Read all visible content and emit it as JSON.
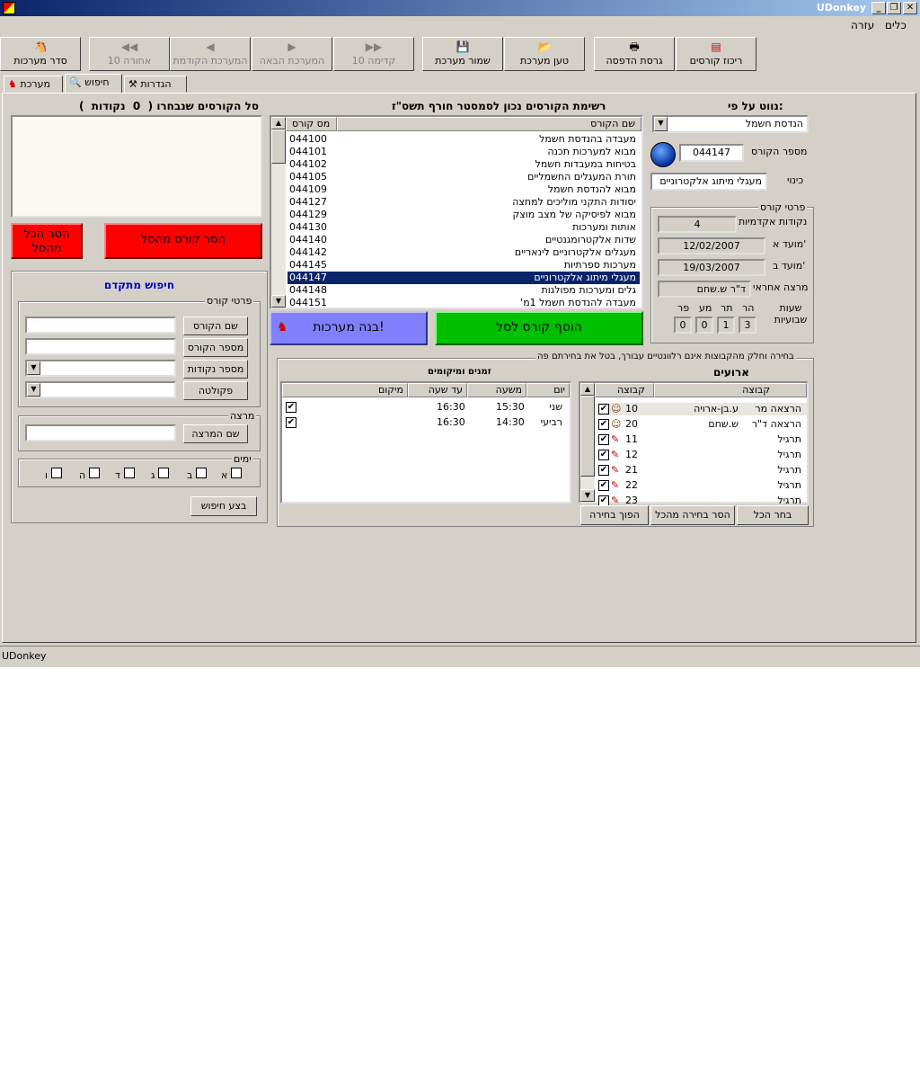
{
  "window": {
    "title": "UDonkey"
  },
  "menu": {
    "tools": "כלים",
    "help": "עזרה"
  },
  "toolbar": {
    "build": "סדר מערכות",
    "last10": "אחורה 10",
    "prev": "המערכת הקודמת",
    "next": "המערכת הבאה",
    "forward10": "קדימה 10",
    "save": "שמור מערכת",
    "load": "טען מערכת",
    "print": "גרסת הדפסה",
    "summary": "ריכוז קורסים"
  },
  "tabs": {
    "schedule": "מערכת",
    "search": "חיפוש",
    "settings": "הגדרות"
  },
  "basket": {
    "title": "סל הקורסים שנבחרו",
    "open": "(",
    "points": "0",
    "points_label": "נקודות",
    "close": ")",
    "remove_all": "הסר הכל מהסל",
    "remove_course": "הסר קורס מהסל"
  },
  "search": {
    "title": "חיפוש מתקדם",
    "course_details": "פרטי קורס",
    "course_name": "שם הקורס",
    "course_number": "מספר הקורס",
    "points": "מספר נקודות",
    "faculty": "פקולטה",
    "lecturer_group": "מרצה",
    "lecturer_name": "שם המרצה",
    "days_group": "ימים",
    "days": [
      "א",
      "ב",
      "ג",
      "ד",
      "ה",
      "ו"
    ],
    "do_search": "בצע חיפוש"
  },
  "course_list": {
    "title": "רשימת הקורסים נכון לסמסטר חורף תשס\"ז",
    "col_name": "שם הקורס",
    "col_number": "מס קורס",
    "rows": [
      {
        "name": "מעבדה בהנדסת חשמל",
        "number": "044100"
      },
      {
        "name": "מבוא למערכות תכנה",
        "number": "044101"
      },
      {
        "name": "בטיחות במעבדות חשמל",
        "number": "044102"
      },
      {
        "name": "תורת המעגלים החשמליים",
        "number": "044105"
      },
      {
        "name": "מבוא להנדסת חשמל",
        "number": "044109"
      },
      {
        "name": "יסודות התקני מוליכים למחצה",
        "number": "044127"
      },
      {
        "name": "מבוא לפיסיקה של מצב מוצק",
        "number": "044129"
      },
      {
        "name": "אותות ומערכות",
        "number": "044130"
      },
      {
        "name": "שדות אלקטרומגנטיים",
        "number": "044140"
      },
      {
        "name": "מעגלים אלקטרוניים לינאריים",
        "number": "044142"
      },
      {
        "name": "מערכות ספרתיות",
        "number": "044145"
      },
      {
        "name": "מעגלי מיתוג אלקטרוניים",
        "number": "044147"
      },
      {
        "name": "גלים ומערכות מפולגות",
        "number": "044148"
      },
      {
        "name": "מעבדה להנדסת חשמל 1מ'",
        "number": "044151"
      }
    ],
    "selected_index": 11,
    "add_to_basket": "הוסף קורס לסל",
    "build_schedule": "בנה מערכות!"
  },
  "sort": {
    "label": "נווט על פי:",
    "value": "הנדסת חשמל"
  },
  "course_info": {
    "number_label": "מספר הקורס",
    "number": "044147",
    "name_label": "כינוי",
    "name": "מעגלי מיתוג אלקטרוניים",
    "details_group": "פרטי קורס",
    "points_label": "נקודות אקדמיות",
    "points": "4",
    "exam_a_label": "מועד א'",
    "exam_a": "12/02/2007",
    "exam_b_label": "מועד ב'",
    "exam_b": "19/03/2007",
    "lecturer_label": "מרצה אחראי",
    "lecturer": "ד\"ר ש.שחם",
    "hours_label": "שעות שבועיות",
    "hours_headers": [
      "הר",
      "תר",
      "מע",
      "פר"
    ],
    "hours_values": [
      "3",
      "1",
      "0",
      "0"
    ]
  },
  "groups": {
    "hint": "בחירה וחלק מהקבוצות אינם רלוונטיים עבורך, בטל את בחירתם פה",
    "events_title": "ארועים",
    "col_group": "קבוצה",
    "col_group_num": "קבוצה",
    "rows": [
      {
        "num": "10",
        "type": "הרצאה מר",
        "lecturer": "ע.בן-ארויה"
      },
      {
        "num": "20",
        "type": "הרצאה ד\"ר",
        "lecturer": "ש.שחם"
      },
      {
        "num": "11",
        "type": "תרגיל",
        "lecturer": ""
      },
      {
        "num": "12",
        "type": "תרגיל",
        "lecturer": ""
      },
      {
        "num": "21",
        "type": "תרגיל",
        "lecturer": ""
      },
      {
        "num": "22",
        "type": "תרגיל",
        "lecturer": ""
      },
      {
        "num": "23",
        "type": "תרגיל",
        "lecturer": ""
      }
    ],
    "times_title": "זמנים ומיקומים",
    "col_day": "יום",
    "col_from": "משעה",
    "col_to": "עד שעה",
    "col_place": "מיקום",
    "times": [
      {
        "day": "שני",
        "from": "15:30",
        "to": "16:30"
      },
      {
        "day": "רביעי",
        "from": "14:30",
        "to": "16:30"
      }
    ],
    "select_all": "בחר הכל",
    "deselect_all": "הסר בחירה מהכל",
    "invert": "הפוך בחירה"
  },
  "status": {
    "text": "UDonkey"
  }
}
